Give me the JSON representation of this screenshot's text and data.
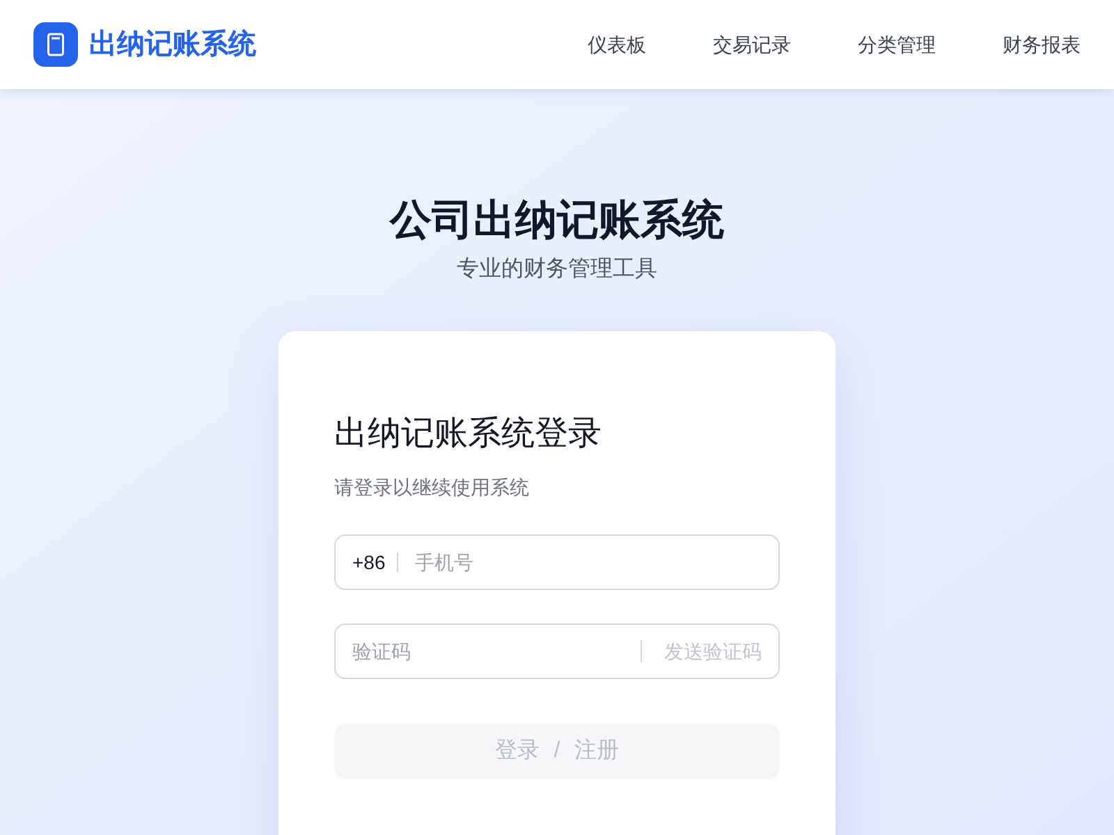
{
  "header": {
    "brand": "出纳记账系统",
    "nav": [
      "仪表板",
      "交易记录",
      "分类管理",
      "财务报表"
    ]
  },
  "hero": {
    "title": "公司出纳记账系统",
    "subtitle": "专业的财务管理工具"
  },
  "login": {
    "title": "出纳记账系统登录",
    "subtitle": "请登录以继续使用系统",
    "phone": {
      "prefix": "+86",
      "placeholder": "手机号"
    },
    "code": {
      "placeholder": "验证码",
      "send_button": {
        "label": "发送验证码",
        "disabled": true
      }
    },
    "submit": {
      "label": "登录 / 注册",
      "disabled": true
    }
  }
}
